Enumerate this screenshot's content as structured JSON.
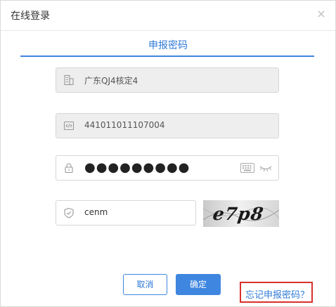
{
  "window": {
    "title": "在线登录",
    "close_glyph": "×"
  },
  "tab": {
    "label": "申报密码"
  },
  "fields": {
    "company": {
      "icon": "building-icon",
      "value": "广东QJ4核定4"
    },
    "tax_id": {
      "icon": "code-icon",
      "value": "441011011107004"
    },
    "password": {
      "icon": "lock-icon",
      "value": "●●●●●●●●●"
    },
    "captcha_input": {
      "icon": "shield-icon",
      "value": "cenm"
    }
  },
  "captcha": {
    "text": "e7p8"
  },
  "buttons": {
    "cancel": "取消",
    "ok": "确定"
  },
  "links": {
    "forgot_password": "忘记申报密码？"
  },
  "colors": {
    "accent": "#3e86df",
    "highlight": "#d8302b"
  }
}
